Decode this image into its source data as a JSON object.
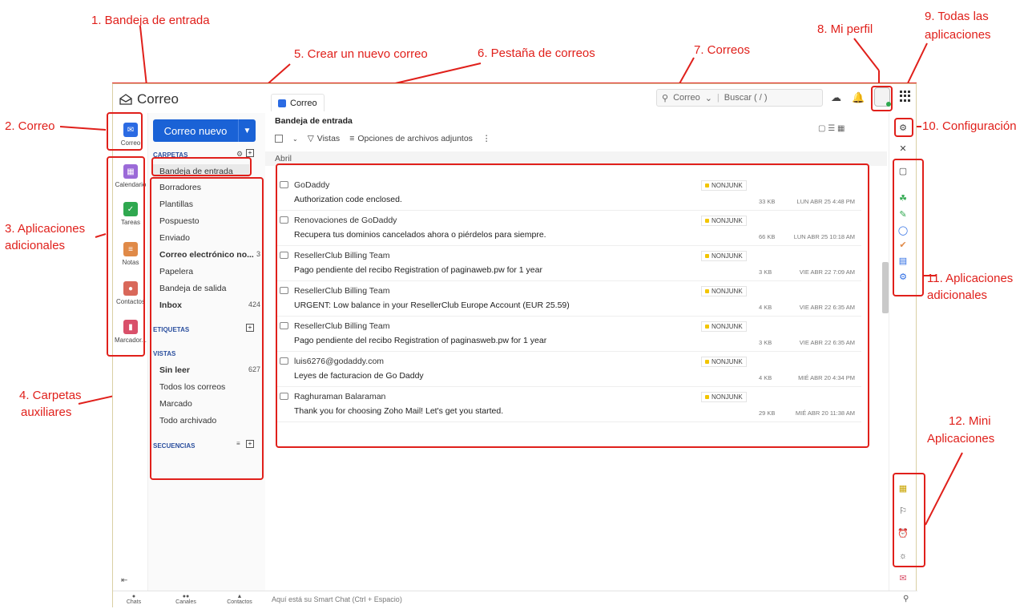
{
  "annotations": {
    "a1": "1. Bandeja de entrada",
    "a2": "2. Correo",
    "a3_line1": "3. Aplicaciones",
    "a3_line2": "adicionales",
    "a4_line1": "4. Carpetas",
    "a4_line2": "auxiliares",
    "a5": "5. Crear un nuevo correo",
    "a6": "6. Pestaña de correos",
    "a7": "7. Correos",
    "a8": "8. Mi perfil",
    "a9_line1": "9. Todas las",
    "a9_line2": "aplicaciones",
    "a10": "10. Configuración",
    "a11_line1": "11. Aplicaciones",
    "a11_line2": "adicionales",
    "a12_line1": "12. Mini",
    "a12_line2": "Aplicaciones"
  },
  "app": {
    "title": "Correo",
    "tab_label": "Correo",
    "search_scope": "Correo",
    "search_placeholder": "Buscar ( / )"
  },
  "rail": {
    "items": [
      {
        "label": "Correo",
        "color": "#2b6be3"
      },
      {
        "label": "Calendario",
        "color": "#9b6ad8"
      },
      {
        "label": "Tareas",
        "color": "#2fa84f"
      },
      {
        "label": "Notas",
        "color": "#e08a48"
      },
      {
        "label": "Contactos",
        "color": "#d9685a"
      },
      {
        "label": "Marcador...",
        "color": "#d9506a"
      }
    ]
  },
  "folders": {
    "new_button": "Correo nuevo",
    "carpetas_title": "CARPETAS",
    "items": [
      {
        "label": "Bandeja de entrada",
        "count": ""
      },
      {
        "label": "Borradores",
        "count": ""
      },
      {
        "label": "Plantillas",
        "count": ""
      },
      {
        "label": "Pospuesto",
        "count": ""
      },
      {
        "label": "Enviado",
        "count": ""
      },
      {
        "label": "Correo electrónico no...",
        "count": "3"
      },
      {
        "label": "Papelera",
        "count": ""
      },
      {
        "label": "Bandeja de salida",
        "count": ""
      },
      {
        "label": "Inbox",
        "count": "424"
      }
    ],
    "etiquetas_title": "ETIQUETAS",
    "vistas_title": "VISTAS",
    "vistas": [
      {
        "label": "Sin leer",
        "count": "627"
      },
      {
        "label": "Todos los correos",
        "count": ""
      },
      {
        "label": "Marcado",
        "count": ""
      },
      {
        "label": "Todo archivado",
        "count": ""
      }
    ],
    "secuencias_title": "SECUENCIAS"
  },
  "footer": {
    "chats": "Chats",
    "canales": "Canales",
    "contactos": "Contactos",
    "smart_chat": "Aquí está su Smart Chat (Ctrl + Espacio)"
  },
  "list": {
    "header": "Bandeja de entrada",
    "vistas": "Vistas",
    "attach_options": "Opciones de archivos adjuntos",
    "month": "Abril",
    "mails": [
      {
        "from": "GoDaddy",
        "subject": "Authorization code enclosed.",
        "tag": "NONJUNK",
        "size": "33 KB",
        "date": "LUN ABR 25 4:48 PM"
      },
      {
        "from": "Renovaciones de GoDaddy",
        "subject": "Recupera tus dominios cancelados ahora o piérdelos para siempre.",
        "tag": "NONJUNK",
        "size": "66 KB",
        "date": "LUN ABR 25 10:18 AM"
      },
      {
        "from": "ResellerClub Billing Team",
        "subject": "Pago pendiente del recibo Registration of paginaweb.pw for 1 year",
        "tag": "NONJUNK",
        "size": "3 KB",
        "date": "VIE ABR 22 7:09 AM"
      },
      {
        "from": "ResellerClub Billing Team",
        "subject": "URGENT: Low balance in your ResellerClub Europe Account (EUR 25.59)",
        "tag": "NONJUNK",
        "size": "4 KB",
        "date": "VIE ABR 22 6:35 AM"
      },
      {
        "from": "ResellerClub Billing Team",
        "subject": "Pago pendiente del recibo Registration of paginasweb.pw for 1 year",
        "tag": "NONJUNK",
        "size": "3 KB",
        "date": "VIE ABR 22 6:35 AM"
      },
      {
        "from": "luis6276@godaddy.com",
        "subject": "Leyes de facturacion de Go Daddy",
        "tag": "NONJUNK",
        "size": "4 KB",
        "date": "MIÉ ABR 20 4:34 PM"
      },
      {
        "from": "Raghuraman Balaraman",
        "subject": "Thank you for choosing Zoho Mail! Let's get you started.",
        "tag": "NONJUNK",
        "size": "29 KB",
        "date": "MIÉ ABR 20 11:38 AM"
      }
    ]
  }
}
